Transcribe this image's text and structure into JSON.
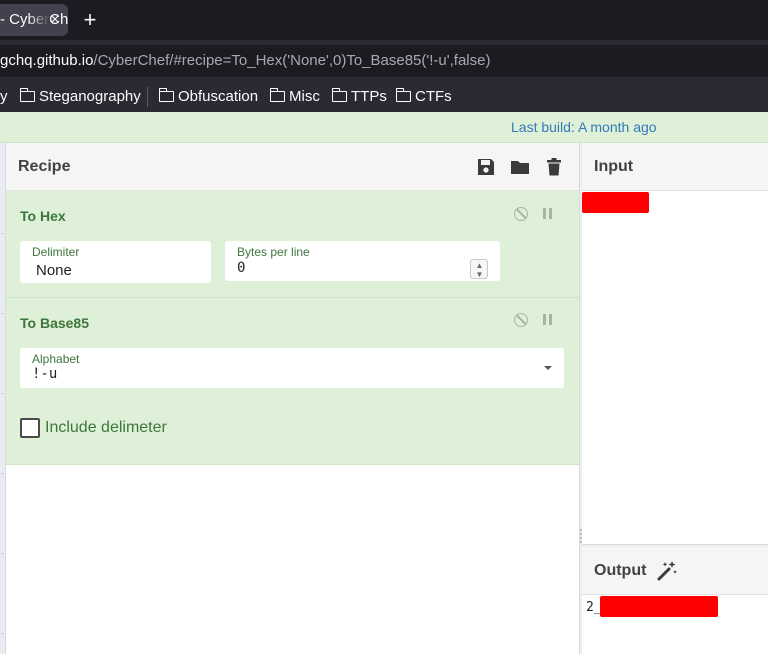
{
  "browser": {
    "tab": {
      "title": "- CyberChef",
      "close_glyph": "×"
    },
    "new_tab_glyph": "+",
    "url": {
      "host": "gchq.github.io",
      "path": "/CyberChef/#recipe=To_Hex('None',0)To_Base85('!-u',false)"
    },
    "bookmarks": [
      {
        "label": "y",
        "icon": "folder-icon"
      },
      {
        "label": "Steganography",
        "icon": "folder-icon"
      },
      {
        "label": "Obfuscation",
        "icon": "folder-icon"
      },
      {
        "label": "Misc",
        "icon": "folder-icon"
      },
      {
        "label": "TTPs",
        "icon": "folder-icon"
      },
      {
        "label": "CTFs",
        "icon": "folder-icon"
      }
    ]
  },
  "banner": {
    "text": "Last build: A month ago",
    "color": "#337ab7"
  },
  "recipe": {
    "title": "Recipe",
    "buttons": [
      "save-icon",
      "folder-open-icon",
      "trash-icon"
    ],
    "operations": [
      {
        "name": "To Hex",
        "fields": [
          {
            "label": "Delimiter",
            "value": "None"
          },
          {
            "label": "Bytes per line",
            "value": "0"
          }
        ]
      },
      {
        "name": "To Base85",
        "fields": [
          {
            "label": "Alphabet",
            "value": "!-u"
          }
        ],
        "checkbox": {
          "label": "Include delimeter",
          "checked": false
        }
      }
    ]
  },
  "input": {
    "title": "Input",
    "redacted": true
  },
  "output": {
    "title": "Output",
    "magic_icon": "magic-wand-icon",
    "prefix_text": "2_",
    "redacted": true
  },
  "colors": {
    "op_bg": "#dff0d8",
    "op_text": "#3c763d",
    "redaction": "#ff0000"
  }
}
